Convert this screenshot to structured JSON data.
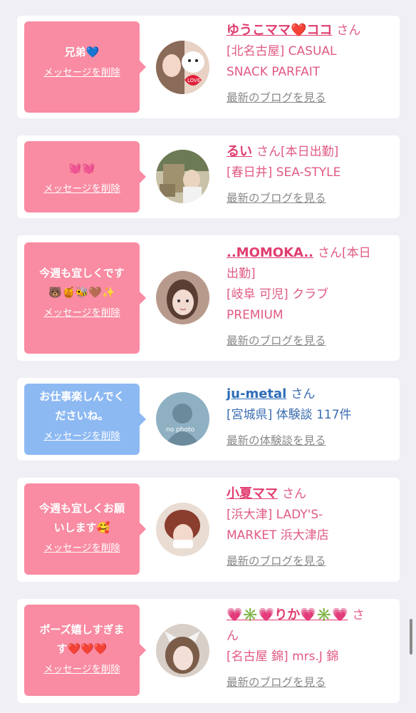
{
  "delete_label": "メッセージを削除",
  "honorific": "さん",
  "cards": [
    {
      "bubble_color": "pink",
      "message": "兄弟💙",
      "name": "ゆうこママ❤️ココ",
      "status": "",
      "location_line1": "[北名古屋] CASUAL",
      "location_line2": "SNACK PARFAIT",
      "link": "最新のブログを見る"
    },
    {
      "bubble_color": "pink",
      "message": "💓💓",
      "name": "るい",
      "status": "[本日出勤]",
      "location_line1": "[春日井] SEA-STYLE",
      "location_line2": "",
      "link": "最新のブログを見る"
    },
    {
      "bubble_color": "pink",
      "message_line1": "今週も宜しくです",
      "message_line2": "🐻🍯🐝🤎✨",
      "name": "..MOMOKA..",
      "status_line1": "[本日",
      "status_line2": "出勤]",
      "location_line1": "[岐阜 可児] クラブ",
      "location_line2": "PREMIUM",
      "link": "最新のブログを見る"
    },
    {
      "bubble_color": "blue",
      "message_line1": "お仕事楽しんでく",
      "message_line2": "ださいね。",
      "name": "ju-metal",
      "status": "",
      "location_line1": "[宮城県] 体験談 117件",
      "location_line2": "",
      "link": "最新の体験談を見る",
      "avatar_text": "no photo"
    },
    {
      "bubble_color": "pink",
      "message_line1": "今週も宜しくお願",
      "message_line2": "いします🥰",
      "name": "小夏ママ",
      "status": "",
      "location_line1": "[浜大津] LADY'S-",
      "location_line2": "MARKET 浜大津店",
      "link": "最新のブログを見る"
    },
    {
      "bubble_color": "pink",
      "message_line1": "ポーズ嬉しすぎま",
      "message_line2": "す❤️❤️❤️",
      "name": "💗✳️💗りか💗✳️💗",
      "honorific_line1": "さ",
      "honorific_line2": "ん",
      "location_line1": "[名古屋 錦] mrs.J 錦",
      "location_line2": "",
      "link": "最新のブログを見る"
    }
  ],
  "colors": {
    "page_bg": "#f0eff5",
    "pink_bubble": "#f98ba2",
    "blue_bubble": "#8db9f3",
    "name_pink": "#e03d6e",
    "name_blue": "#2f6db8",
    "link_gray": "#888888"
  }
}
